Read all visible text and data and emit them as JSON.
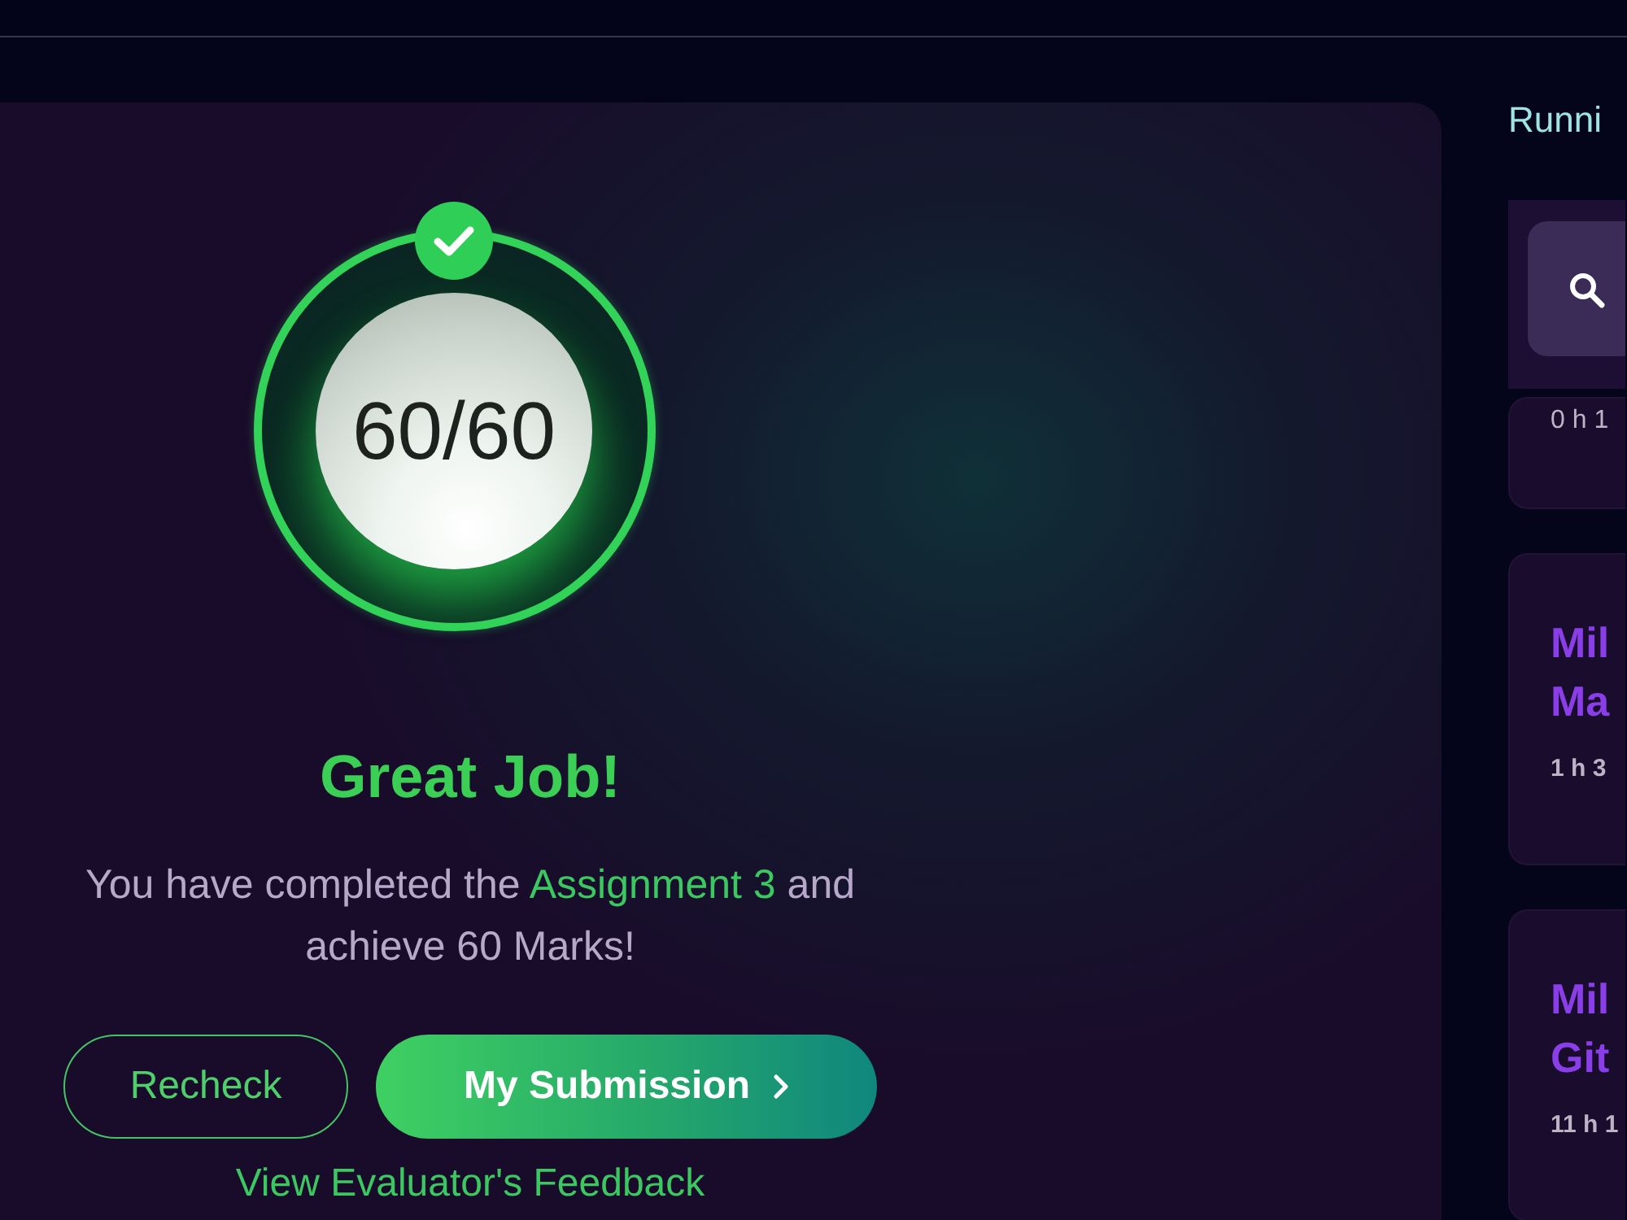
{
  "result": {
    "score": "60/60",
    "passed": true,
    "heading": "Great Job!",
    "message": [
      {
        "text": "You have completed the ",
        "kind": "plain"
      },
      {
        "text": "Assignment 3",
        "kind": "highlight"
      },
      {
        "text": " and achieve 60 Marks!",
        "kind": "plain"
      }
    ],
    "buttons": [
      {
        "label": "Recheck",
        "kind": "outline"
      },
      {
        "label": "My Submission",
        "kind": "primary"
      }
    ],
    "feedback_link": "View Evaluator's Feedback"
  },
  "sidebar": {
    "heading": "Runni",
    "cards": [
      {
        "duration": "0 h 1"
      },
      {
        "title_lines": [
          "Mil",
          "Ma"
        ],
        "duration": "1 h 3"
      },
      {
        "title_lines": [
          "Mil",
          "Git"
        ],
        "duration": "11 h 1"
      }
    ]
  }
}
